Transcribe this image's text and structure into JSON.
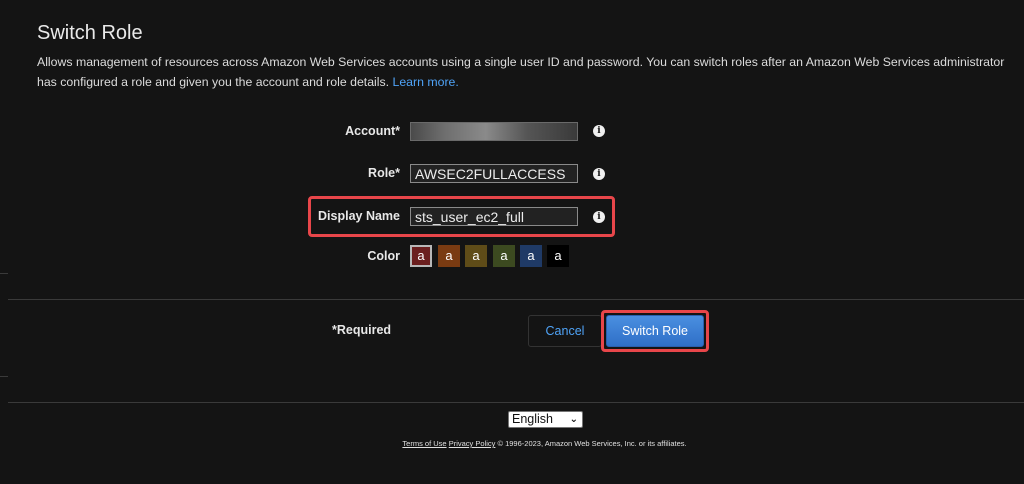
{
  "header": {
    "title": "Switch Role",
    "description": "Allows management of resources across Amazon Web Services accounts using a single user ID and password. You can switch roles after an Amazon Web Services administrator has configured a role and given you the account and role details.",
    "learn_more": "Learn more."
  },
  "form": {
    "account_label": "Account*",
    "account_value": "",
    "role_label": "Role*",
    "role_value": "AWSEC2FULLACCESS",
    "display_name_label": "Display Name",
    "display_name_value": "sts_user_ec2_full",
    "color_label": "Color",
    "info_glyph": "i",
    "swatches": [
      {
        "letter": "a",
        "color": "#6b1f1f"
      },
      {
        "letter": "a",
        "color": "#7a3b12"
      },
      {
        "letter": "a",
        "color": "#5f4c18"
      },
      {
        "letter": "a",
        "color": "#3c4a20"
      },
      {
        "letter": "a",
        "color": "#1f3a66"
      },
      {
        "letter": "a",
        "color": "#000000"
      }
    ]
  },
  "actions": {
    "required_label": "*Required",
    "cancel_label": "Cancel",
    "switch_label": "Switch Role"
  },
  "footer": {
    "language": "English",
    "terms": "Terms of Use",
    "privacy": "Privacy Policy",
    "copyright": "© 1996-2023, Amazon Web Services, Inc. or its affiliates."
  },
  "colors": {
    "background": "#141414",
    "link": "#4fa3f7",
    "highlight": "#e8464a",
    "primary_button": "#3a7bd5"
  }
}
